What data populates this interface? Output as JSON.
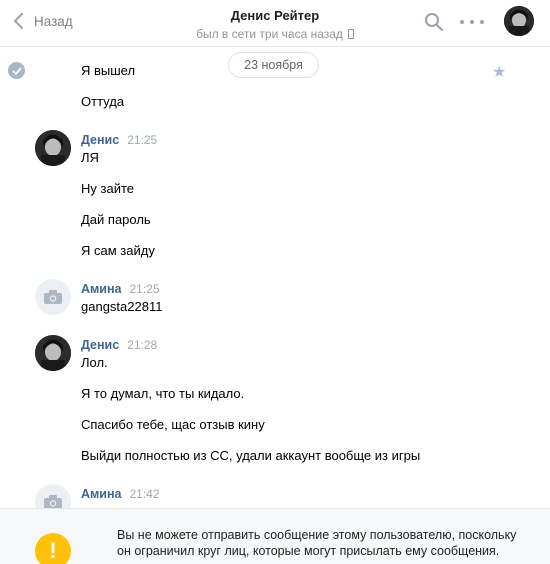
{
  "header": {
    "back_label": "Назад",
    "peer_name": "Денис Рейтер",
    "peer_status": "был в сети три часа назад",
    "icons": [
      "chevron-left-icon",
      "phone-icon",
      "search-icon",
      "more-icon"
    ]
  },
  "date_divider": "23 ноября",
  "groups": [
    {
      "author": "",
      "time": "",
      "lines": [
        "Я вышел",
        "Оттуда"
      ]
    },
    {
      "author": "Денис",
      "time": "21:25",
      "lines": [
        "ЛЯ",
        "Ну зайте",
        "Дай пароль",
        "Я сам зайду"
      ]
    },
    {
      "author": "Амина",
      "time": "21:25",
      "lines": [
        "gangsta22811"
      ]
    },
    {
      "author": "Денис",
      "time": "21:28",
      "lines": [
        "Лол.",
        "Я то думал, что ты кидало.",
        "Спасибо тебе, щас отзыв кину",
        "Выйди полностью из СС, удали аккаунт вообще из игры"
      ]
    },
    {
      "author": "Амина",
      "time": "21:42",
      "lines": []
    }
  ],
  "notice": {
    "icon": "exclamation-icon",
    "text": "Вы не можете отправить сообщение этому пользователю, поскольку он ограничил круг лиц, которые могут присылать ему сообщения."
  },
  "colors": {
    "author_link": "#42648b",
    "warning": "#ffc107",
    "muted": "#939393"
  }
}
